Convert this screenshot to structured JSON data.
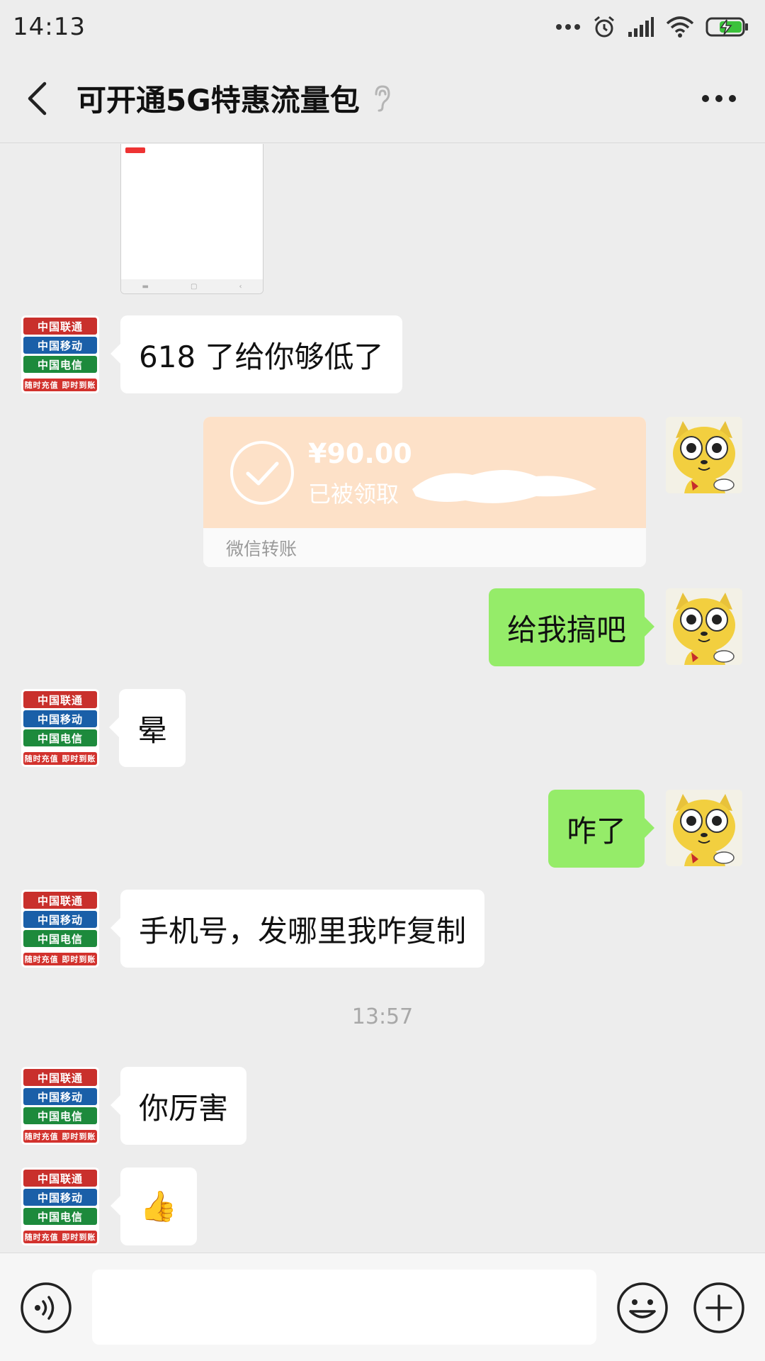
{
  "status_bar": {
    "time": "14:13"
  },
  "header": {
    "title": "可开通5G特惠流量包"
  },
  "avatar_labels": {
    "line1": "中国联通",
    "line2": "中国移动",
    "line3": "中国电信",
    "tag": "随时充值 即时到账"
  },
  "messages": [
    {
      "side": "in",
      "text": "618 了给你够低了"
    },
    {
      "side": "out",
      "type": "transfer",
      "amount": "¥90.00",
      "status": "已被领取",
      "footer": "微信转账"
    },
    {
      "side": "out",
      "text": "给我搞吧"
    },
    {
      "side": "in",
      "text": "晕"
    },
    {
      "side": "out",
      "text": "咋了"
    },
    {
      "side": "in",
      "text": "手机号，发哪里我咋复制"
    },
    {
      "type": "timestamp",
      "text": "13:57"
    },
    {
      "side": "in",
      "text": "你厉害"
    },
    {
      "side": "in",
      "text": "👍"
    }
  ],
  "input_bar": {
    "value": "",
    "placeholder": ""
  },
  "icons": {
    "back": "back-arrow-icon",
    "ear": "ear-icon",
    "more": "more-dots-icon",
    "voice": "voice-icon",
    "emoji": "emoji-icon",
    "plus": "plus-icon"
  },
  "colors": {
    "background": "#ededed",
    "outgoing_bubble": "#95ec69",
    "incoming_bubble": "#ffffff",
    "transfer_card": "#fde1c8"
  }
}
